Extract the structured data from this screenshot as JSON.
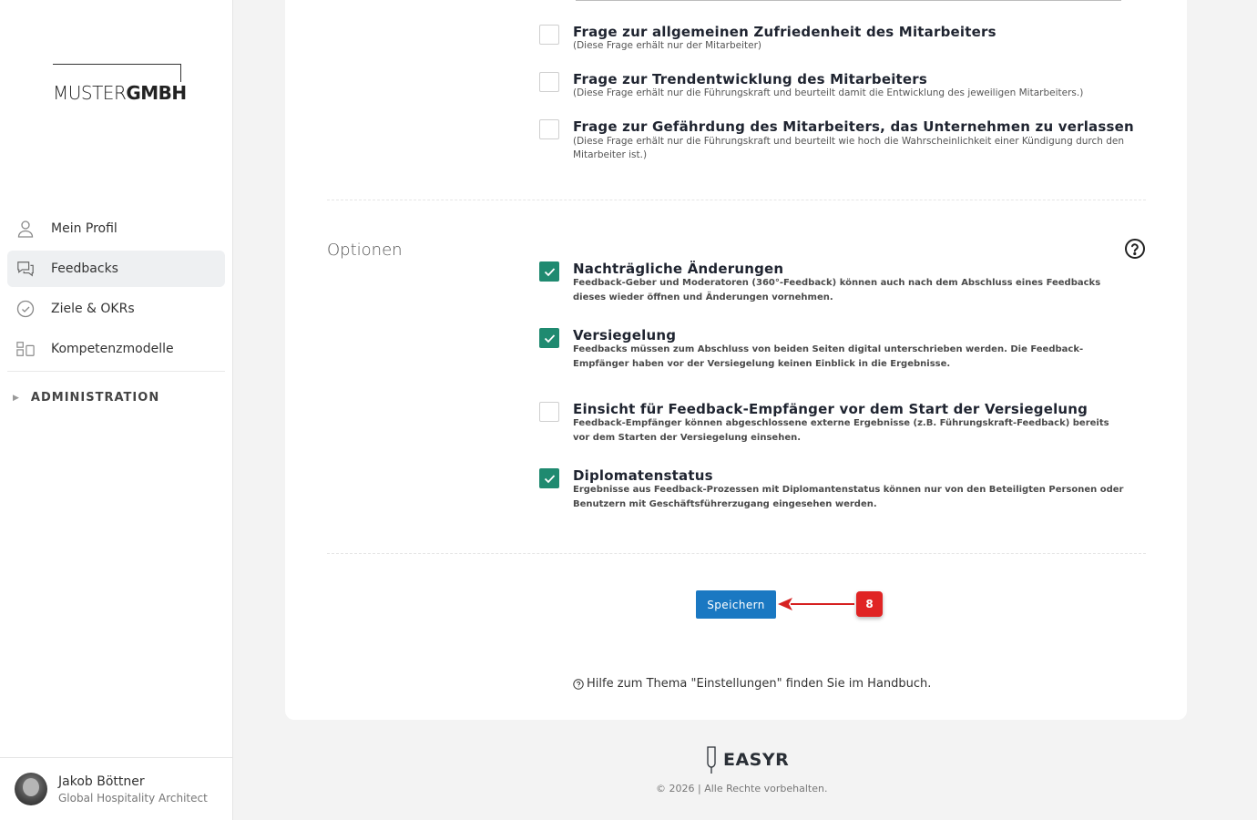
{
  "brand": {
    "logo_thin": "MUSTER",
    "logo_bold": "GMBH"
  },
  "sidebar": {
    "items": [
      {
        "label": "Mein Profil",
        "icon": "user-icon",
        "active": false
      },
      {
        "label": "Feedbacks",
        "icon": "chat-icon",
        "active": true
      },
      {
        "label": "Ziele & OKRs",
        "icon": "check-circle-icon",
        "active": false
      },
      {
        "label": "Kompetenzmodelle",
        "icon": "blocks-icon",
        "active": false
      }
    ],
    "admin_label": "ADMINISTRATION",
    "admin_caret": "▶"
  },
  "user": {
    "name": "Jakob Böttner",
    "role": "Global Hospitality Architect"
  },
  "questions": [
    {
      "title": "Frage zur allgemeinen Zufriedenheit des Mitarbeiters",
      "desc": "(Diese Frage erhält nur der Mitarbeiter)",
      "checked": false
    },
    {
      "title": "Frage zur Trendentwicklung des Mitarbeiters",
      "desc": "(Diese Frage erhält nur die Führungskraft und beurteilt damit die Entwicklung des jeweiligen Mitarbeiters.)",
      "checked": false
    },
    {
      "title": "Frage zur Gefährdung des Mitarbeiters, das Unternehmen zu verlassen",
      "desc": "(Diese Frage erhält nur die Führungskraft und beurteilt wie hoch die Wahrscheinlichkeit einer Kündigung durch den Mitarbeiter ist.)",
      "checked": false
    }
  ],
  "options_section": {
    "label": "Optionen",
    "items": [
      {
        "title": "Nachträgliche Änderungen",
        "desc": "Feedback-Geber und Moderatoren (360°-Feedback) können auch nach dem Abschluss eines Feedbacks dieses wieder öffnen und Änderungen vornehmen.",
        "checked": true
      },
      {
        "title": "Versiegelung",
        "desc": "Feedbacks müssen zum Abschluss von beiden Seiten digital unterschrieben werden. Die Feedback-Empfänger haben vor der Versiegelung keinen Einblick in die Ergebnisse.",
        "checked": true
      },
      {
        "title": "Einsicht für Feedback-Empfänger vor dem Start der Versiegelung",
        "desc": "Feedback-Empfänger können abgeschlossene externe Ergebnisse (z.B. Führungskraft-Feedback) bereits vor dem Starten der Versiegelung einsehen.",
        "checked": false
      },
      {
        "title": "Diplomatenstatus",
        "desc": "Ergebnisse aus Feedback-Prozessen mit Diplomantenstatus können nur von den Beteiligten Personen oder Benutzern mit Geschäftsführerzugang eingesehen werden.",
        "checked": true
      }
    ]
  },
  "actions": {
    "save_label": "Speichern",
    "annotation_badge": "8"
  },
  "help": {
    "text": "Hilfe zum Thema \"Einstellungen\" finden Sie im Handbuch."
  },
  "footer": {
    "logo": "EASYR",
    "copyright": "© 2026 | Alle Rechte vorbehalten."
  },
  "colors": {
    "accent_green": "#1f8a70",
    "primary_blue": "#1a78c2",
    "badge_red": "#e02424"
  }
}
